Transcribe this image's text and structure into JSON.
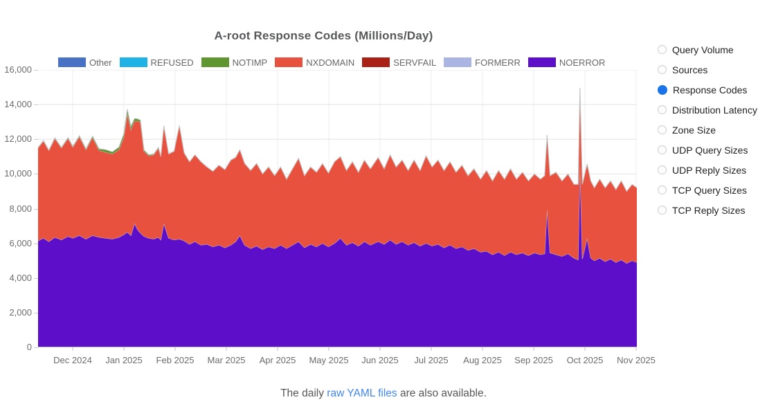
{
  "page": {
    "background": "#ffffff"
  },
  "chart_data": {
    "type": "area",
    "stacked": true,
    "title": "A-root Response Codes (Millions/Day)",
    "units": "Millions/Day",
    "xlabel": "",
    "ylabel": "",
    "ylim": [
      0,
      16000
    ],
    "grid": true,
    "legend_position": "top",
    "y_ticks": [
      "0",
      "2,000",
      "4,000",
      "6,000",
      "8,000",
      "10,000",
      "12,000",
      "14,000",
      "16,000"
    ],
    "x_ticks": [
      "Dec 2024",
      "Jan 2025",
      "Feb 2025",
      "Mar 2025",
      "Apr 2025",
      "May 2025",
      "Jun 2025",
      "Jul 2025",
      "Aug 2025",
      "Sep 2025",
      "Oct 2025",
      "Nov 2025"
    ],
    "x_pct": [
      0,
      0.9,
      1.8,
      2.8,
      3.9,
      5,
      5.8,
      6.9,
      8,
      9.1,
      10.2,
      11.3,
      12.4,
      13.5,
      14.3,
      14.9,
      15.5,
      16.1,
      16.6,
      17.1,
      17.7,
      18.5,
      19.3,
      20.1,
      20.5,
      21,
      21.8,
      22.7,
      23.6,
      24.4,
      25.3,
      26.2,
      27.2,
      28.2,
      29.2,
      30.2,
      31.2,
      32.2,
      33,
      33.7,
      34.5,
      35.5,
      36.5,
      37.5,
      38.5,
      39.5,
      40.5,
      41.5,
      42.5,
      43.5,
      44.5,
      45.5,
      46.5,
      47.5,
      48.5,
      49.5,
      50.5,
      51.5,
      52.5,
      53.5,
      54.5,
      55.5,
      56.8,
      57.8,
      58.8,
      59.8,
      60.8,
      61.8,
      62.8,
      63.8,
      64.8,
      65.8,
      66.8,
      67.8,
      68.8,
      69.8,
      70.8,
      71.8,
      72.8,
      73.9,
      74.9,
      75.9,
      76.9,
      77.9,
      78.9,
      79.9,
      80.9,
      81.9,
      82.9,
      83.9,
      84.6,
      85,
      85.5,
      86.5,
      87.5,
      88.5,
      89.5,
      90.2,
      90.5,
      90.9,
      91.7,
      92.3,
      92.9,
      93.8,
      94.7,
      95.6,
      96.5,
      97.4,
      98.3,
      99.2,
      100
    ],
    "series": [
      {
        "name": "NOERROR",
        "color": "#5c0ec8",
        "values": [
          6150,
          6300,
          6100,
          6350,
          6200,
          6400,
          6300,
          6450,
          6250,
          6450,
          6350,
          6300,
          6250,
          6350,
          6500,
          6650,
          6450,
          7150,
          6800,
          6600,
          6400,
          6300,
          6250,
          6350,
          6200,
          7150,
          6300,
          6200,
          6250,
          6150,
          5950,
          6100,
          5900,
          5950,
          5800,
          5900,
          5750,
          5900,
          6100,
          6450,
          5900,
          5700,
          5850,
          5650,
          5800,
          5700,
          5900,
          5700,
          5900,
          6100,
          5750,
          5950,
          5800,
          6000,
          5800,
          6000,
          6300,
          5900,
          6050,
          5850,
          6100,
          5900,
          6100,
          5950,
          6200,
          5950,
          6100,
          5900,
          6050,
          5850,
          6000,
          5850,
          5950,
          5750,
          5900,
          5700,
          5800,
          5600,
          5700,
          5500,
          5550,
          5350,
          5500,
          5300,
          5500,
          5350,
          5450,
          5300,
          5450,
          5350,
          5400,
          8000,
          5450,
          5350,
          5250,
          5400,
          5150,
          5050,
          10600,
          5100,
          6300,
          5150,
          5000,
          5150,
          4950,
          5100,
          4900,
          5050,
          4850,
          5000,
          4900
        ]
      },
      {
        "name": "FORMERR",
        "color": "#aab5e2",
        "values": 0
      },
      {
        "name": "SERVFAIL",
        "color": "#aa2116",
        "values": 0
      },
      {
        "name": "NXDOMAIN",
        "color": "#e8513d",
        "values": [
          5350,
          5600,
          5250,
          5700,
          5300,
          5650,
          5250,
          5700,
          5150,
          5650,
          5000,
          4950,
          4900,
          5050,
          5600,
          6850,
          6100,
          5900,
          6250,
          6400,
          4900,
          4750,
          4850,
          5150,
          4800,
          5610,
          4850,
          5100,
          6530,
          5050,
          4750,
          5000,
          4800,
          4450,
          4350,
          4600,
          4500,
          4900,
          4850,
          4940,
          4700,
          4500,
          4750,
          4350,
          4600,
          4200,
          4500,
          4000,
          4400,
          4800,
          4150,
          4450,
          4300,
          4600,
          4250,
          4700,
          4700,
          4300,
          4650,
          4250,
          4700,
          4400,
          4850,
          4350,
          4900,
          4450,
          4700,
          4300,
          4750,
          4350,
          5050,
          4550,
          4850,
          4450,
          4800,
          4400,
          4700,
          4300,
          4600,
          4200,
          4650,
          4250,
          4700,
          4400,
          4800,
          4350,
          4650,
          4300,
          4550,
          4350,
          4500,
          4250,
          4450,
          4750,
          4350,
          4600,
          4250,
          4350,
          4350,
          4300,
          4280,
          4450,
          4200,
          4550,
          4250,
          4500,
          4200,
          4550,
          4150,
          4400,
          4300
        ]
      },
      {
        "name": "NOTIMP",
        "color": "#5f9630",
        "values": [
          30,
          30,
          30,
          40,
          40,
          50,
          50,
          60,
          60,
          80,
          100,
          150,
          120,
          150,
          200,
          250,
          200,
          150,
          130,
          100,
          80,
          60,
          50,
          40,
          30,
          30,
          20,
          20,
          20,
          20,
          10,
          10,
          10,
          10,
          10,
          10,
          10,
          10,
          10,
          10,
          10,
          10,
          10,
          10,
          10,
          10,
          0,
          0,
          0,
          0,
          0,
          0,
          0,
          0,
          0,
          0,
          0,
          0,
          0,
          0,
          0,
          0,
          0,
          0,
          0,
          0,
          0,
          0,
          0,
          0,
          0,
          0,
          0,
          0,
          0,
          0,
          0,
          0,
          0,
          0,
          0,
          0,
          0,
          0,
          0,
          0,
          0,
          0,
          0,
          0,
          0,
          0,
          0,
          0,
          0,
          0,
          0,
          0,
          0,
          0,
          0,
          0,
          0,
          0,
          0,
          0,
          0,
          0,
          0,
          0,
          0
        ]
      },
      {
        "name": "REFUSED",
        "color": "#1fb2e5",
        "values": 0
      },
      {
        "name": "Other",
        "color": "#4a72c4",
        "values": 0
      }
    ]
  },
  "sidebar": {
    "items": [
      {
        "label": "Query Volume",
        "selected": false
      },
      {
        "label": "Sources",
        "selected": false
      },
      {
        "label": "Response Codes",
        "selected": true
      },
      {
        "label": "Distribution Latency",
        "selected": false
      },
      {
        "label": "Zone Size",
        "selected": false
      },
      {
        "label": "UDP Query Sizes",
        "selected": false
      },
      {
        "label": "UDP Reply Sizes",
        "selected": false
      },
      {
        "label": "TCP Query Sizes",
        "selected": false
      },
      {
        "label": "TCP Reply Sizes",
        "selected": false
      }
    ],
    "selected_color": "#1a73e8"
  },
  "caption": {
    "prefix": "The daily ",
    "link_text": "raw YAML files",
    "suffix": " are also available.",
    "link_color": "#4285f4"
  }
}
